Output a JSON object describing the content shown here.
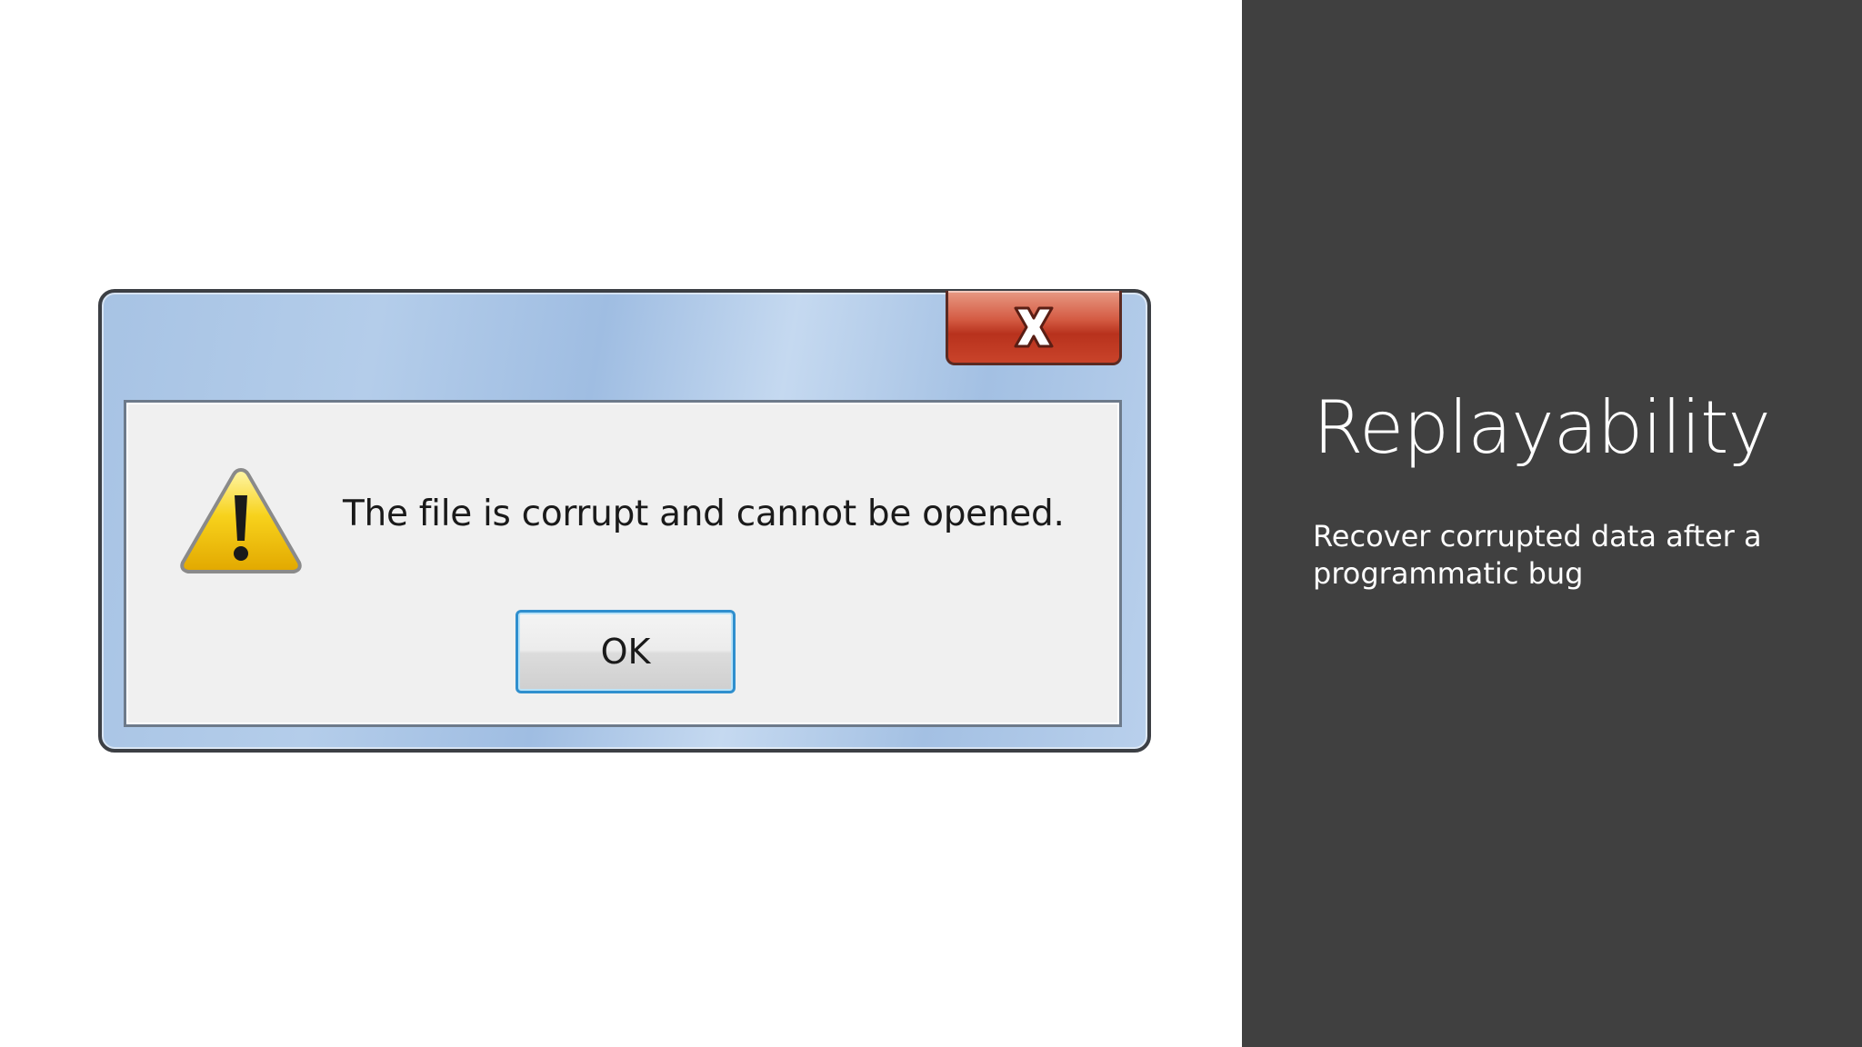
{
  "dialog": {
    "message": "The file is corrupt and cannot be opened.",
    "ok_label": "OK",
    "close_icon": "close-x-icon",
    "message_icon": "warning-icon"
  },
  "slide": {
    "title": "Replayability",
    "subtitle": "Recover corrupted data after a programmatic bug"
  },
  "colors": {
    "panel_background": "#404040",
    "slide_background": "#ffffff",
    "close_button": "#c9432a",
    "ok_button_border": "#2f8fce",
    "warning_yellow": "#f5c400"
  }
}
